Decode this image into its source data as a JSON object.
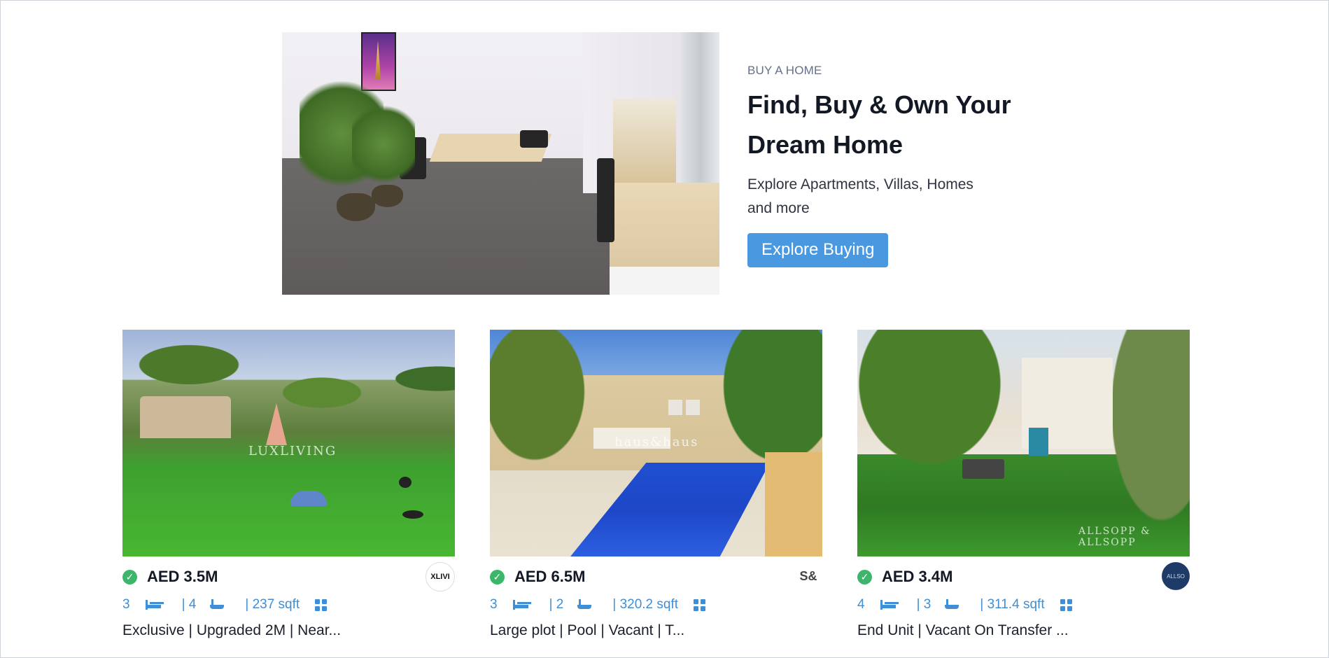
{
  "hero": {
    "eyebrow": "BUY A HOME",
    "title_line1": "Find, Buy & Own Your",
    "title_line2": "Dream Home",
    "subtitle": "Explore Apartments, Villas, Homes and more",
    "cta_label": "Explore Buying"
  },
  "listings": [
    {
      "price": "AED 3.5M",
      "beds": "3",
      "baths": "| 4",
      "area": "| 237 sqft",
      "title": "Exclusive | Upgraded 2M | Near...",
      "agency_logo_text": "XLIVI",
      "watermark": "LUXLIVING"
    },
    {
      "price": "AED 6.5M",
      "beds": "3",
      "baths": "| 2",
      "area": "| 320.2 sqft",
      "title": "Large plot | Pool | Vacant | T...",
      "agency_logo_text": "S&",
      "watermark": "haus&haus"
    },
    {
      "price": "AED 3.4M",
      "beds": "4",
      "baths": "| 3",
      "area": "| 311.4 sqft",
      "title": "End Unit | Vacant On Transfer ...",
      "agency_logo_text": "ALLSO",
      "watermark": "ALLSOPP & ALLSOPP"
    }
  ],
  "colors": {
    "accent": "#4a99e0",
    "verified": "#3bb66b",
    "meta_text": "#3f8ed6"
  },
  "icons": {
    "verified": "check-circle-icon",
    "beds": "bed-icon",
    "baths": "bathtub-icon",
    "area": "grid-icon"
  }
}
